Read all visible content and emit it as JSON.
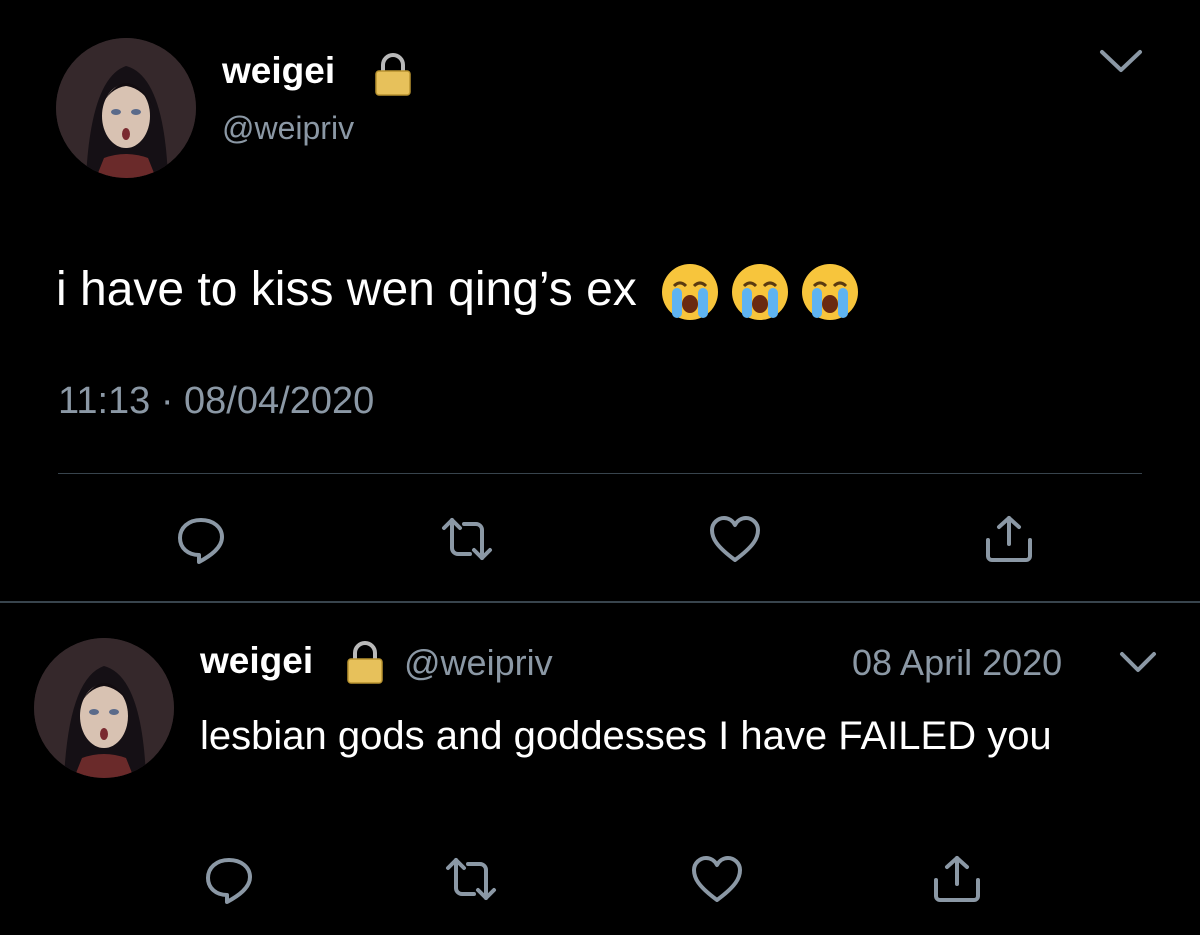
{
  "main_tweet": {
    "display_name": "weigei",
    "handle": "@weipriv",
    "text": "i have to kiss wen qing’s ex",
    "emoji": [
      "loudly-crying-face",
      "loudly-crying-face",
      "loudly-crying-face"
    ],
    "timestamp": "11:13 · 08/04/2020",
    "actions": [
      "reply-icon",
      "retweet-icon",
      "like-icon",
      "share-icon"
    ]
  },
  "reply_tweet": {
    "display_name": "weigei",
    "handle": "@weipriv",
    "date": "08 April 2020",
    "text": "lesbian gods and goddesses I have FAILED you",
    "actions": [
      "reply-icon",
      "retweet-icon",
      "like-icon",
      "share-icon"
    ]
  },
  "colors": {
    "background": "#000000",
    "text": "#ffffff",
    "muted": "#8b98a5",
    "divider": "#38444d",
    "lock": "#e7c15b"
  }
}
